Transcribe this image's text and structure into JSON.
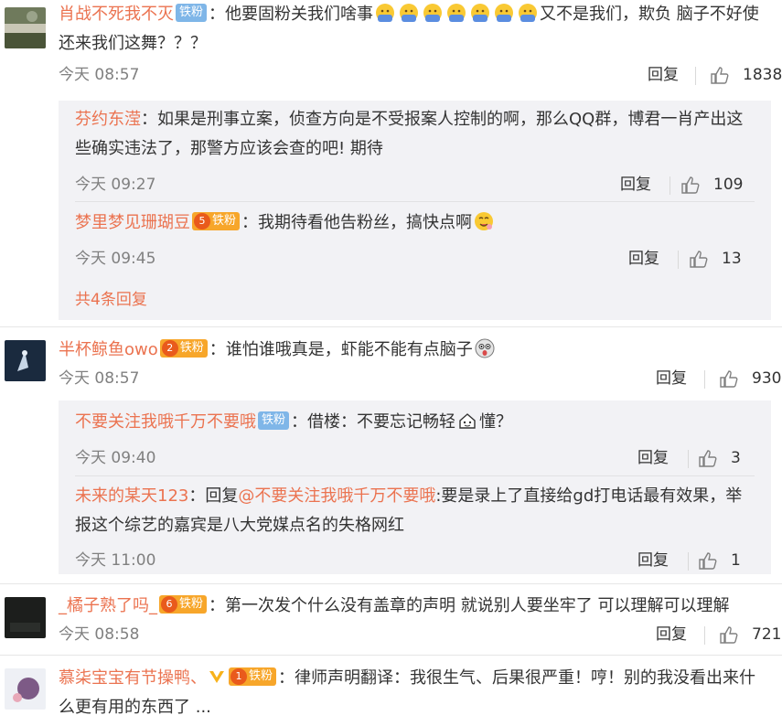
{
  "comments": [
    {
      "user": "肖战不死我不灭",
      "badge": "铁粉",
      "text_a": "：他要固粉关我们啥事",
      "text_b": "又不是我们，欺负 脑子不好使还来我们这舞？？？",
      "time": "今天 08:57",
      "reply": "回复",
      "likes": "1838",
      "replies": [
        {
          "user": "芬约东滢",
          "text": "：如果是刑事立案，侦查方向是不受报案人控制的啊，那么QQ群，博君一肖产出这些确实违法了，那警方应该会查的吧! 期待",
          "time": "今天 09:27",
          "reply": "回复",
          "likes": "109"
        },
        {
          "user": "梦里梦见珊瑚豆",
          "level": "5",
          "badge": "铁粉",
          "text": "：我期待看他告粉丝，搞快点啊",
          "time": "今天 09:45",
          "reply": "回复",
          "likes": "13"
        }
      ],
      "more": "共4条回复"
    },
    {
      "user": "半杯鲸鱼owo",
      "level": "2",
      "badge": "铁粉",
      "text": "：谁怕谁哦真是，虾能不能有点脑子",
      "time": "今天 08:57",
      "reply": "回复",
      "likes": "930",
      "replies": [
        {
          "user": "不要关注我哦千万不要哦",
          "badge": "铁粉",
          "text_a": "：借楼：不要忘记畅轻",
          "text_b": "懂？",
          "time": "今天 09:40",
          "reply": "回复",
          "likes": "3"
        },
        {
          "user": "未来的某天123",
          "text_a": "：回复",
          "mention": "@不要关注我哦千万不要哦",
          "text_b": ":要是录上了直接给gd打电话最有效果，举报这个综艺的嘉宾是八大党媒点名的失格网红",
          "time": "今天 11:00",
          "reply": "回复",
          "likes": "1"
        }
      ]
    },
    {
      "user": "_橘子熟了吗_",
      "level": "6",
      "badge": "铁粉",
      "text": "：第一次发个什么没有盖章的声明 就说别人要坐牢了 可以理解可以理解",
      "time": "今天 08:58",
      "reply": "回复",
      "likes": "721"
    },
    {
      "user": "慕柒宝宝有节操鸭、",
      "level": "1",
      "badge": "铁粉",
      "text": "：律师声明翻译：我很生气、后果很严重！哼！别的我没看出来什么更有用的东西了 ..."
    }
  ],
  "colors": {
    "accent": "#eb7350",
    "subbg": "#f2f2f5",
    "badge_blue": "#7fb6e8",
    "badge_orange": "#f7a62a"
  }
}
